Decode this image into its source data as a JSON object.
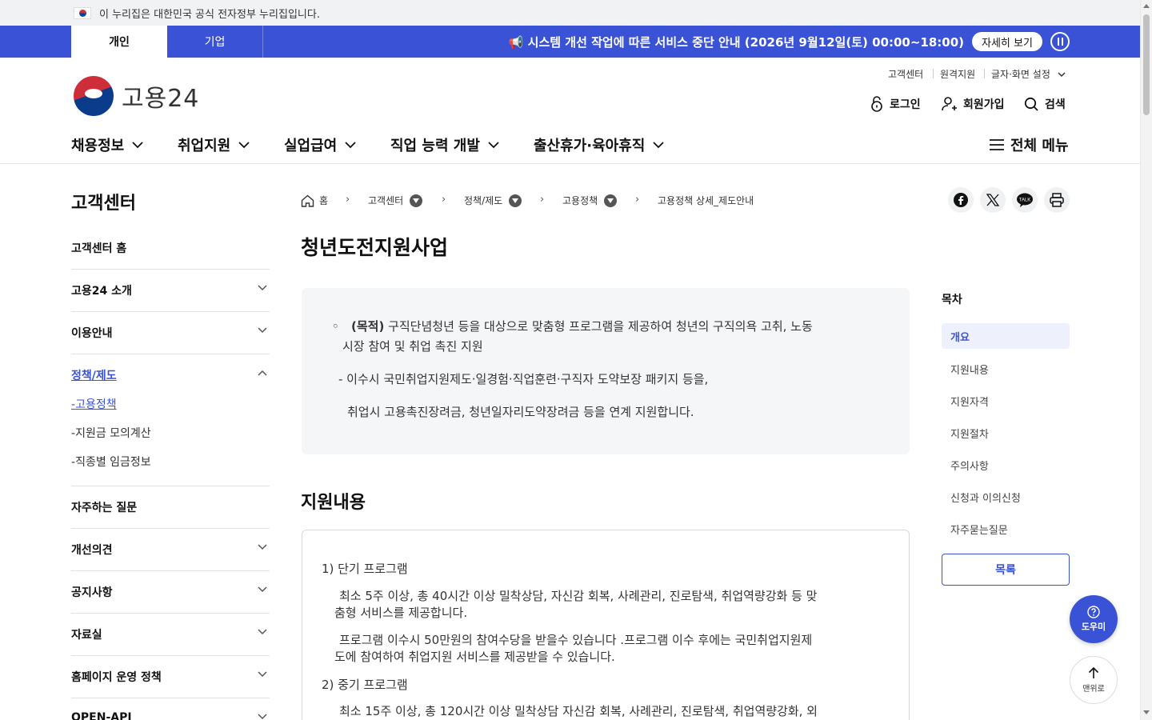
{
  "topbar": {
    "text": "이 누리집은 대한민국 공식 전자정부 누리집입니다."
  },
  "notice": {
    "tabs": [
      "개인",
      "기업"
    ],
    "text": "📢 시스템 개선 작업에 따른 서비스 중단 안내 (2026년 9월12일(토) 00:00~18:00)",
    "detail_button": "자세히 보기"
  },
  "header": {
    "logo_text": "고용24",
    "util": [
      "고객센터",
      "원격지원",
      "글자·화면 설정"
    ],
    "login": "로그인",
    "signup": "회원가입",
    "search": "검색"
  },
  "gnb": {
    "items": [
      "채용정보",
      "취업지원",
      "실업급여",
      "직업 능력 개발",
      "출산휴가·육아휴직"
    ],
    "all_menu": "전체 메뉴"
  },
  "lnb": {
    "title": "고객센터",
    "items": [
      "고객센터 홈",
      "고용24 소개",
      "이용안내",
      "정책/제도",
      "자주하는 질문",
      "개선의견",
      "공지사항",
      "자료실",
      "홈페이지 운영 정책",
      "OPEN-API"
    ],
    "subitems": [
      "고용정책",
      "지원금 모의계산",
      "직종별 임금정보"
    ]
  },
  "breadcrumb": [
    "홈",
    "고객센터",
    "정책/제도",
    "고용정책",
    "고용정책 상세_제도안내"
  ],
  "content": {
    "title": "청년도전지원사업",
    "summary": {
      "bullet": "◦",
      "purpose_label": "(목적)",
      "purpose_line1": " 구직단념청년 등을 대상으로 맞춤형 프로그램을 제공하여 청년의 구직의욕 고취, 노동",
      "purpose_line2": "시장 참여 및 취업 촉진 지원",
      "line3": "-  이수시 국민취업지원제도·일경험·직업훈련·구직자 도약보장 패키지 등을,",
      "line4": "취업시 고용촉진장려금, 청년일자리도약장려금 등을 연계 지원합니다."
    },
    "section_title": "지원내용",
    "box": {
      "p1": "1) 단기 프로그램",
      "p2a": "최소 5주 이상, 총 40시간 이상 밀착상담, 자신감 회복, 사례관리, 진로탐색, 취업역량강화 등 맞",
      "p2b": "춤형 서비스를 제공합니다.",
      "p3a": "프로그램 이수시 50만원의 참여수당을 받을수 있습니다 .프로그램 이수 후에는 국민취업지원제",
      "p3b": "도에 참여하여 취업지원 서비스를 제공받을 수 있습니다.",
      "p4": "2) 중기 프로그램",
      "p5": "최소 15주 이상, 총 120시간 이상 밀착상담 자신감 회복, 사례관리, 진로탐색, 취업역량강화, 외"
    }
  },
  "toc": {
    "title": "목차",
    "items": [
      "개요",
      "지원내용",
      "지원자격",
      "지원절차",
      "주의사항",
      "신청과 이의신청",
      "자주묻는질문"
    ],
    "list_button": "목록"
  },
  "floating": {
    "help": "도우미",
    "top": "맨위로"
  }
}
